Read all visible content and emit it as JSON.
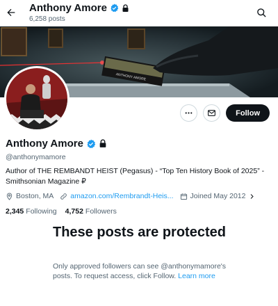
{
  "header": {
    "name": "Anthony Amore",
    "posts_count": "6,258 posts"
  },
  "profile": {
    "display_name": "Anthony Amore",
    "handle": "@anthonymamore",
    "bio": "Author of THE REMBANDT HEIST (Pegasus) - “Top Ten History Book of 2025” - Smithsonian Magazine ₽",
    "location": "Boston, MA",
    "website": "amazon.com/Rembrandt-Heis...",
    "joined": "Joined May 2012",
    "following_count": "2,345",
    "following_label": "Following",
    "followers_count": "4,752",
    "followers_label": "Followers",
    "banner_book_title": "ANTHONY AMORE"
  },
  "actions": {
    "follow_label": "Follow"
  },
  "protected": {
    "title": "These posts are protected",
    "description_prefix": "Only approved followers can see @anthonymamore's posts. To request access, click Follow.",
    "learn_more": "Learn more"
  },
  "colors": {
    "accent": "#1d9bf0",
    "text_primary": "#0f1419",
    "text_secondary": "#536471",
    "button_dark": "#0f1419"
  }
}
